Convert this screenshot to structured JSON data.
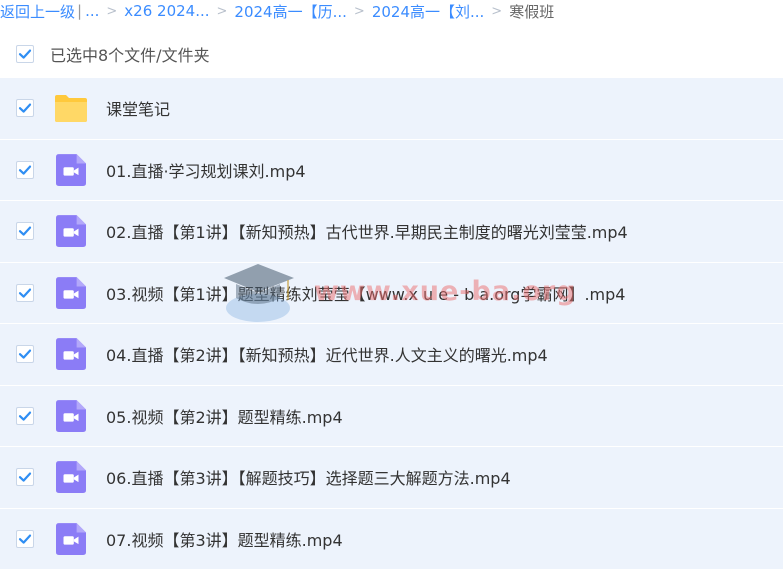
{
  "breadcrumb": {
    "back": "返回上一级",
    "ellipsis": "...",
    "items": [
      "x26 2024...",
      "2024高一【历...",
      "2024高一【刘..."
    ],
    "current": "寒假班"
  },
  "selection": {
    "text": "已选中8个文件/文件夹",
    "checked": true
  },
  "files": [
    {
      "name": "课堂笔记",
      "type": "folder-icon",
      "checked": true
    },
    {
      "name": "01.直播·学习规划课刘.mp4",
      "type": "video-file-icon",
      "checked": true
    },
    {
      "name": "02.直播【第1讲】【新知预热】古代世界.早期民主制度的曙光刘莹莹.mp4",
      "type": "video-file-icon",
      "checked": true
    },
    {
      "name": "03.视频【第1讲】题型精练刘莹莹【www.x u e - b a.org学霸网】.mp4",
      "type": "video-file-icon",
      "checked": true
    },
    {
      "name": "04.直播【第2讲】【新知预热】近代世界.人文主义的曙光.mp4",
      "type": "video-file-icon",
      "checked": true
    },
    {
      "name": "05.视频【第2讲】题型精练.mp4",
      "type": "video-file-icon",
      "checked": true
    },
    {
      "name": "06.直播【第3讲】【解题技巧】选择题三大解题方法.mp4",
      "type": "video-file-icon",
      "checked": true
    },
    {
      "name": "07.视频【第3讲】题型精练.mp4",
      "type": "video-file-icon",
      "checked": true
    }
  ],
  "watermark": {
    "text": "www.xue-ba.org"
  },
  "colors": {
    "link": "#3b8cff",
    "row_bg": "#edf3fc",
    "checkbox": "#2f8ef3",
    "folder": "#ffd15a",
    "video_icon": "#8b7cf6"
  }
}
